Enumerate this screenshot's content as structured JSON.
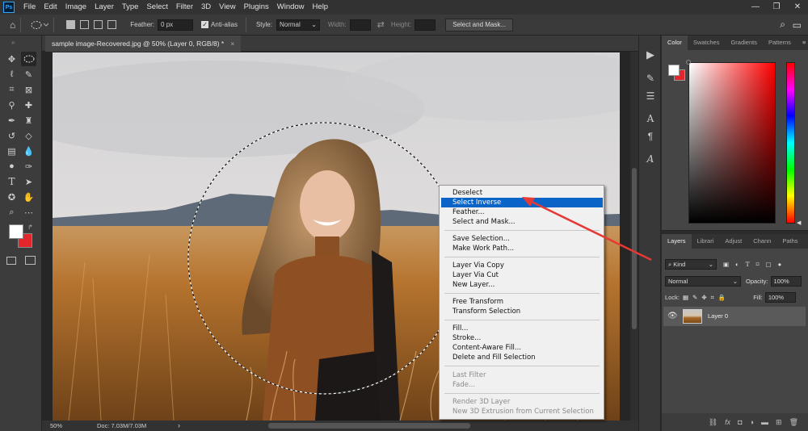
{
  "app": {
    "logo": "Ps"
  },
  "menubar": {
    "items": [
      "File",
      "Edit",
      "Image",
      "Layer",
      "Type",
      "Select",
      "Filter",
      "3D",
      "View",
      "Plugins",
      "Window",
      "Help"
    ],
    "window_controls": [
      "—",
      "❐",
      "✕"
    ]
  },
  "options": {
    "feather_label": "Feather:",
    "feather_value": "0 px",
    "antialias_label": "Anti-alias",
    "style_label": "Style:",
    "style_value": "Normal",
    "width_label": "Width:",
    "height_label": "Height:",
    "select_mask_button": "Select and Mask..."
  },
  "document": {
    "tab_title": "sample image-Recovered.jpg @ 50% (Layer 0, RGB/8) *",
    "close": "×"
  },
  "status": {
    "zoom": "50%",
    "doc_size": "Doc: 7.03M/7.03M",
    "arrow": "›"
  },
  "color_panel": {
    "tabs": [
      "Color",
      "Swatches",
      "Gradients",
      "Patterns"
    ],
    "active_tab": "Color"
  },
  "layers_panel": {
    "tabs": [
      "Layers",
      "Librari",
      "Adjust",
      "Chann",
      "Paths"
    ],
    "filter_kind": "Kind",
    "blend_mode": "Normal",
    "opacity_label": "Opacity:",
    "opacity_value": "100%",
    "lock_label": "Lock:",
    "fill_label": "Fill:",
    "fill_value": "100%",
    "layers": [
      {
        "name": "Layer 0",
        "visible": true
      }
    ]
  },
  "context_menu": {
    "items": {
      "deselect": "Deselect",
      "select_inverse": "Select Inverse",
      "feather": "Feather...",
      "select_and_mask": "Select and Mask...",
      "save_selection": "Save Selection...",
      "make_work_path": "Make Work Path...",
      "layer_via_copy": "Layer Via Copy",
      "layer_via_cut": "Layer Via Cut",
      "new_layer": "New Layer...",
      "free_transform": "Free Transform",
      "transform_selection": "Transform Selection",
      "fill": "Fill...",
      "stroke": "Stroke...",
      "content_aware_fill": "Content-Aware Fill...",
      "delete_and_fill": "Delete and Fill Selection",
      "last_filter": "Last Filter",
      "fade": "Fade...",
      "render_3d_layer": "Render 3D Layer",
      "new_3d_extrusion": "New 3D Extrusion from Current Selection"
    },
    "highlighted": "Select Inverse"
  },
  "colors": {
    "foreground": "#ffffff",
    "background": "#e3262b",
    "highlight": "#0a64c8",
    "annotation_arrow": "#e53935"
  }
}
